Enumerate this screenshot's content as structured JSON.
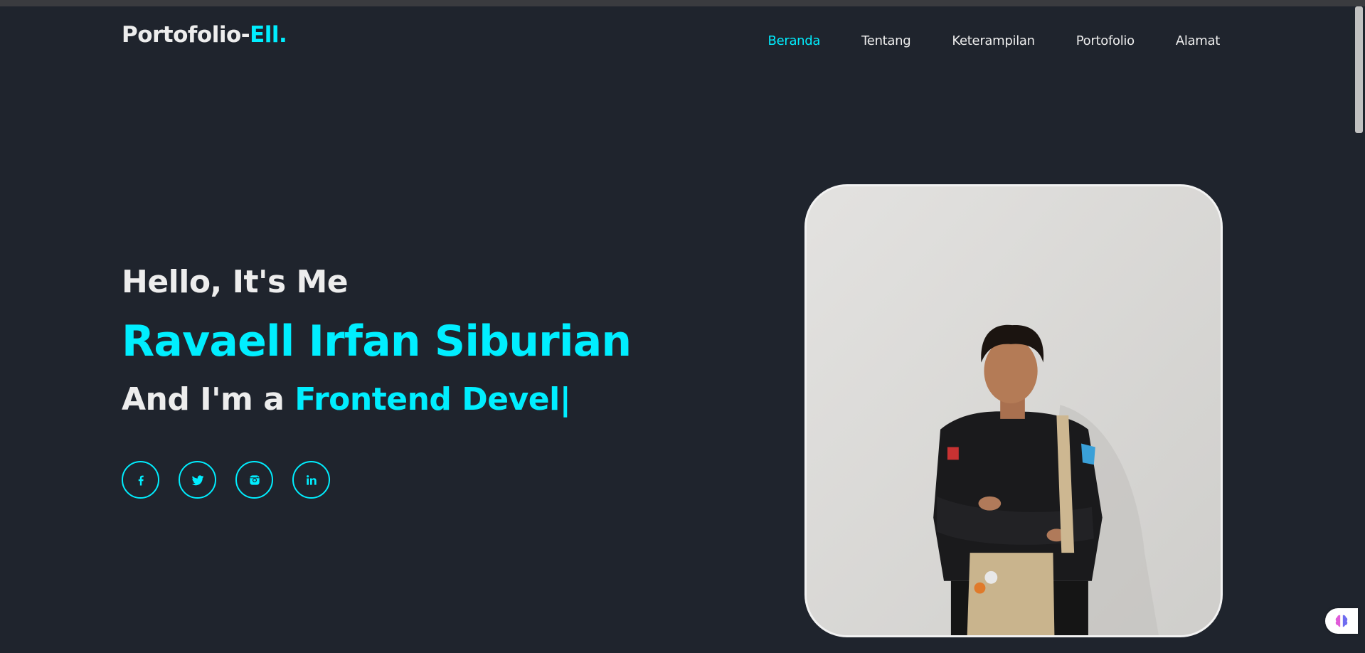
{
  "header": {
    "logo_main": "Portofolio-",
    "logo_accent": "Ell.",
    "nav": [
      {
        "label": "Beranda",
        "active": true
      },
      {
        "label": "Tentang",
        "active": false
      },
      {
        "label": "Keterampilan",
        "active": false
      },
      {
        "label": "Portofolio",
        "active": false
      },
      {
        "label": "Alamat",
        "active": false
      }
    ]
  },
  "hero": {
    "greeting": "Hello, It's Me",
    "name": "Ravaell Irfan Siburian",
    "role_prefix": "And I'm a ",
    "role_typed": "Frontend Devel",
    "cursor": "|",
    "socials": [
      {
        "icon": "facebook-icon"
      },
      {
        "icon": "twitter-icon"
      },
      {
        "icon": "instagram-icon"
      },
      {
        "icon": "linkedin-icon"
      }
    ]
  },
  "colors": {
    "background": "#1f242d",
    "accent": "#00eeff",
    "text": "#ededed"
  },
  "widget": {
    "icon": "brain-icon"
  }
}
